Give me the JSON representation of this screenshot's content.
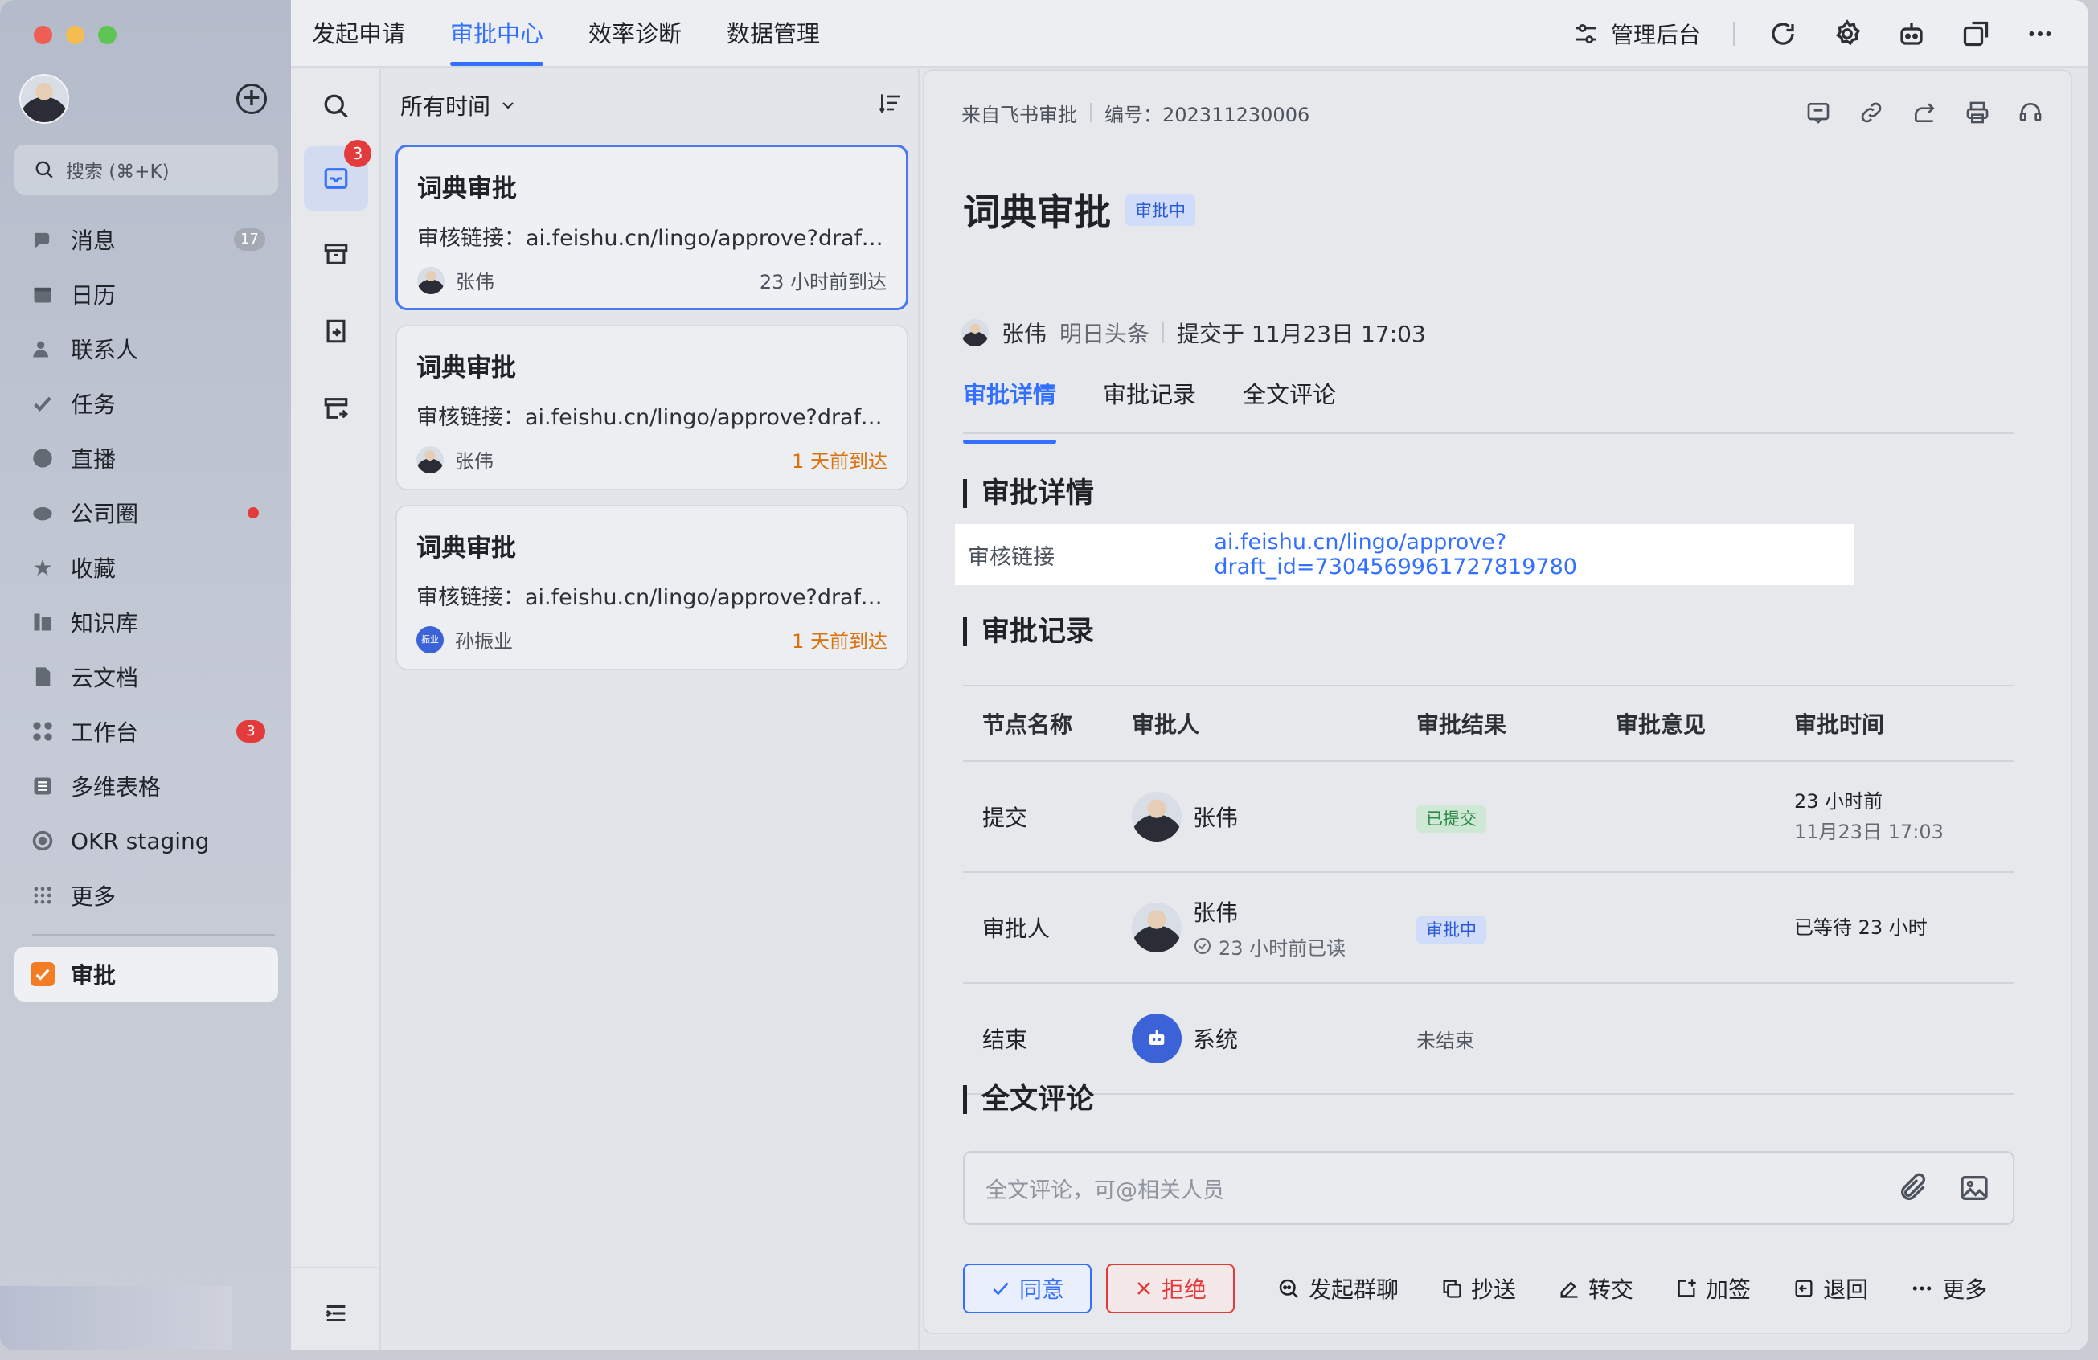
{
  "sidebar": {
    "search_placeholder": "搜索 (⌘+K)",
    "items": [
      {
        "label": "消息",
        "icon": "chat-icon",
        "badge": "17"
      },
      {
        "label": "日历",
        "icon": "calendar-icon"
      },
      {
        "label": "联系人",
        "icon": "contacts-icon"
      },
      {
        "label": "任务",
        "icon": "task-icon"
      },
      {
        "label": "直播",
        "icon": "live-icon"
      },
      {
        "label": "公司圈",
        "icon": "moments-icon"
      },
      {
        "label": "收藏",
        "icon": "star-icon"
      },
      {
        "label": "知识库",
        "icon": "wiki-icon"
      },
      {
        "label": "云文档",
        "icon": "docs-icon"
      },
      {
        "label": "工作台",
        "icon": "workplace-icon",
        "badge": "3"
      },
      {
        "label": "多维表格",
        "icon": "base-icon"
      },
      {
        "label": "OKR staging",
        "icon": "okr-icon"
      },
      {
        "label": "更多",
        "icon": "more-grid-icon"
      }
    ],
    "active_app": {
      "label": "审批",
      "icon": "approval-app-icon"
    }
  },
  "topbar": {
    "tabs": [
      "发起申请",
      "审批中心",
      "效率诊断",
      "数据管理"
    ],
    "active_tab": "审批中心",
    "admin_label": "管理后台"
  },
  "rail": {
    "pending_badge": "3"
  },
  "list": {
    "filter_label": "所有时间",
    "cards": [
      {
        "title": "词典审批",
        "link": "审核链接：ai.feishu.cn/lingo/approve?draft_...",
        "user": "张伟",
        "time": "23 小时前到达"
      },
      {
        "title": "词典审批",
        "link": "审核链接：ai.feishu.cn/lingo/approve?draft_...",
        "user": "张伟",
        "time": "1 天前到达"
      },
      {
        "title": "词典审批",
        "link": "审核链接：ai.feishu.cn/lingo/approve?draft_...",
        "user": "孙振业",
        "user_avatar_text": "振业",
        "time": "1 天前到达"
      }
    ]
  },
  "detail": {
    "source": "来自飞书审批",
    "serial": "编号：202311230006",
    "title": "词典审批",
    "status": "审批中",
    "applicant": "张伟",
    "company": "明日头条",
    "submitted": "提交于 11月23日 17:03",
    "tabs": [
      "审批详情",
      "审批记录",
      "全文评论"
    ],
    "sections": {
      "details": "审批详情",
      "records": "审批记录",
      "comments": "全文评论"
    },
    "field": {
      "key": "审核链接",
      "value": "ai.feishu.cn/lingo/approve?draft_id=7304569961727819780"
    },
    "table": {
      "headers": [
        "节点名称",
        "审批人",
        "审批结果",
        "审批意见",
        "审批时间"
      ],
      "rows": [
        {
          "node": "提交",
          "approver": "张伟",
          "result": "已提交",
          "opinion": "",
          "time": "23 小时前",
          "time2": "11月23日 17:03"
        },
        {
          "node": "审批人",
          "approver": "张伟",
          "approver_sub": "23 小时前已读",
          "result": "审批中",
          "opinion": "",
          "time": "已等待 23 小时"
        },
        {
          "node": "结束",
          "approver": "系统",
          "result": "未结束",
          "opinion": "",
          "time": ""
        }
      ]
    },
    "comment_placeholder": "全文评论，可@相关人员",
    "actions": {
      "agree": "同意",
      "reject": "拒绝",
      "group_chat": "发起群聊",
      "cc": "抄送",
      "transfer": "转交",
      "add_sign": "加签",
      "return": "退回",
      "more": "更多"
    }
  }
}
